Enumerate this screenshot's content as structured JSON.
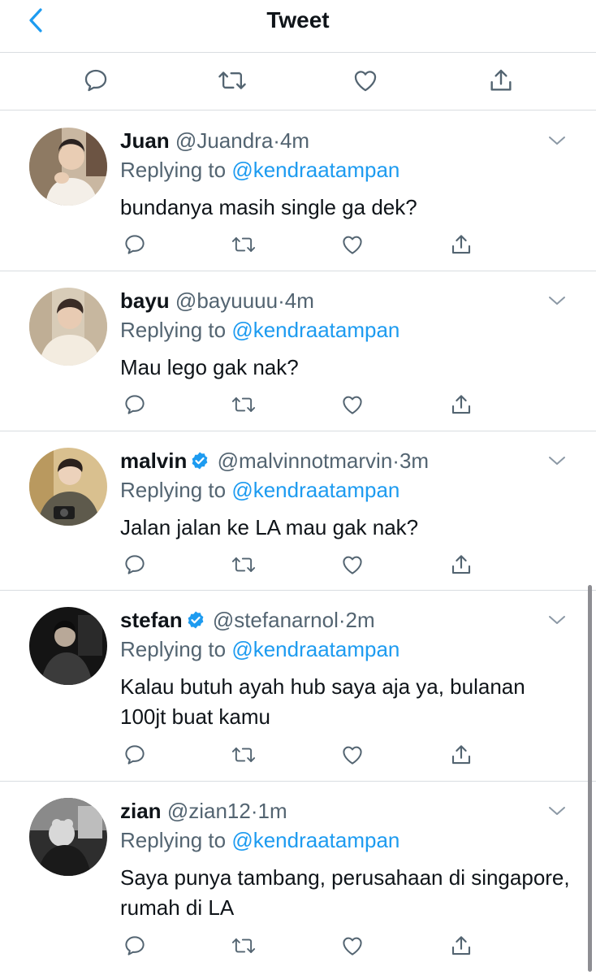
{
  "header": {
    "title": "Tweet",
    "back_icon": "chevron-left-icon"
  },
  "colors": {
    "accent": "#1d9bf0",
    "text": "#0f1419",
    "muted": "#536471",
    "divider": "#d9dde1"
  },
  "replies": [
    {
      "name": "Juan",
      "handle": "@Juandra",
      "sep": "·",
      "time": "4m",
      "replying_prefix": "Replying to",
      "mention": "@kendraatampan",
      "text": "bundanya masih single ga dek?",
      "verified": false
    },
    {
      "name": "bayu",
      "handle": "@bayuuuu",
      "sep": "·",
      "time": "4m",
      "replying_prefix": "Replying to",
      "mention": "@kendraatampan",
      "text": "Mau lego gak nak?",
      "verified": false
    },
    {
      "name": "malvin",
      "handle": "@malvinnotmarvin",
      "sep": "·",
      "time": "3m",
      "replying_prefix": "Replying to",
      "mention": "@kendraatampan",
      "text": "Jalan jalan ke LA mau gak nak?",
      "verified": true
    },
    {
      "name": "stefan",
      "handle": "@stefanarnol",
      "sep": "·",
      "time": "2m",
      "replying_prefix": "Replying to",
      "mention": "@kendraatampan",
      "text": "Kalau butuh ayah hub saya aja ya, bulanan 100jt buat kamu",
      "verified": true
    },
    {
      "name": "zian",
      "handle": "@zian12",
      "sep": "·",
      "time": "1m",
      "replying_prefix": "Replying to",
      "mention": "@kendraatampan",
      "text": "Saya punya tambang, perusahaan di singapore, rumah di LA",
      "verified": false
    }
  ]
}
